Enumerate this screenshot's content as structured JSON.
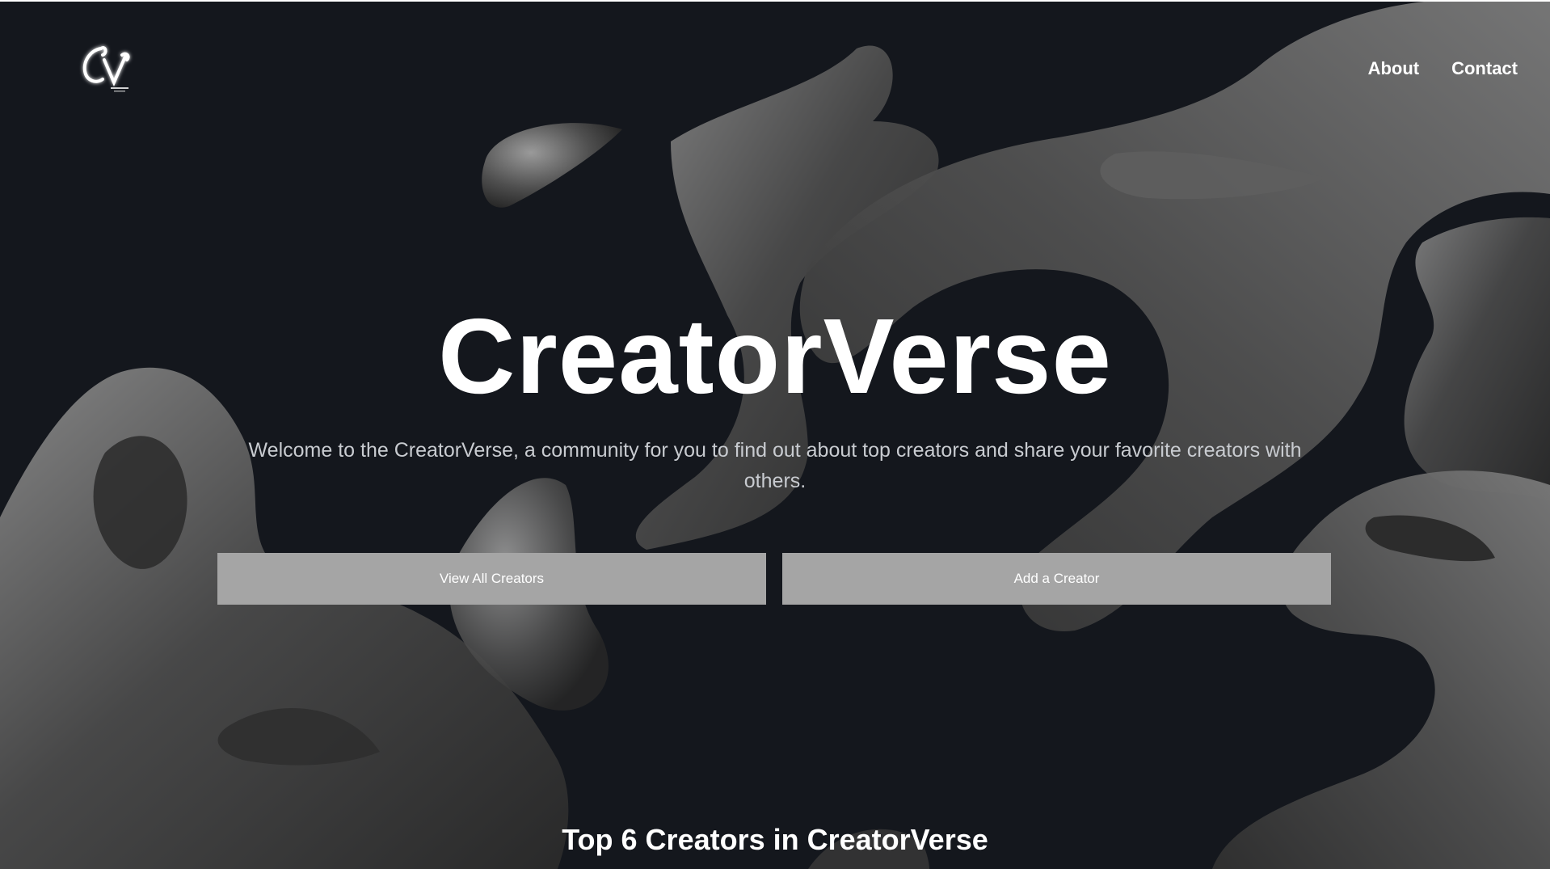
{
  "nav": {
    "logo_alt": "CV",
    "links": [
      {
        "label": "About"
      },
      {
        "label": "Contact"
      }
    ]
  },
  "hero": {
    "title": "CreatorVerse",
    "subtitle": "Welcome to the CreatorVerse, a community for you to find out about top creators and share your favorite creators with others.",
    "buttons": {
      "view_all": "View All Creators",
      "add": "Add a Creator"
    }
  },
  "section": {
    "title": "Top 6 Creators in CreatorVerse"
  },
  "colors": {
    "background": "#14171d",
    "button": "#a5a5a5",
    "text": "#ffffff"
  }
}
